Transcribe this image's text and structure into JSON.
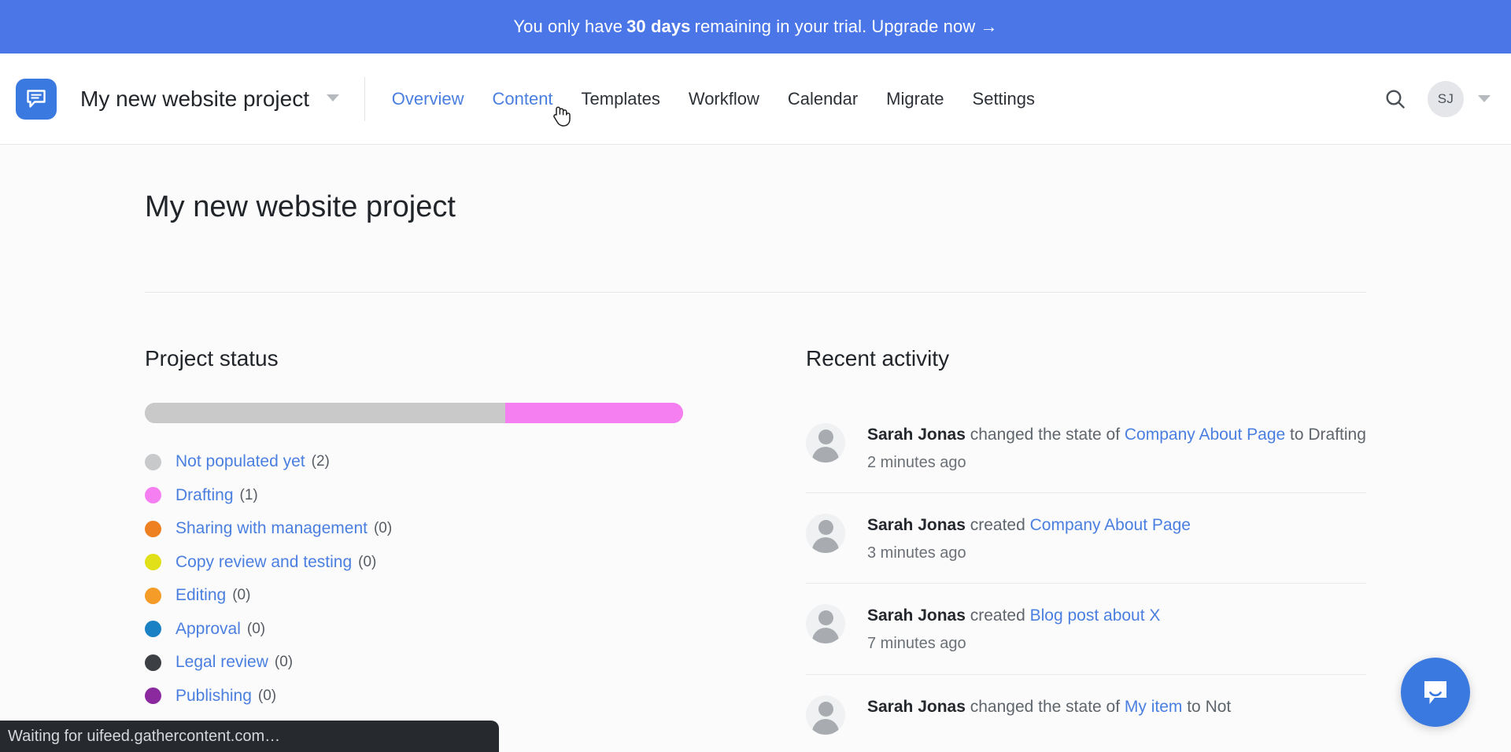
{
  "banner": {
    "pre_text": "You only have",
    "bold_text": "30 days",
    "post_text": "remaining in your trial.",
    "cta": "Upgrade now →",
    "bg_color": "#4a76e8"
  },
  "topnav": {
    "logo_name": "gathercontent-logo-icon",
    "project_name": "My new website project",
    "project_caret": "chevron-down-icon",
    "links": [
      {
        "label": "Overview",
        "state": "active"
      },
      {
        "label": "Content",
        "state": "hovered"
      },
      {
        "label": "Templates",
        "state": "default"
      },
      {
        "label": "Workflow",
        "state": "default"
      },
      {
        "label": "Calendar",
        "state": "default"
      },
      {
        "label": "Migrate",
        "state": "default"
      },
      {
        "label": "Settings",
        "state": "default"
      }
    ],
    "search_icon": "search-icon",
    "avatar_initials": "SJ",
    "avatar_caret": "chevron-down-icon",
    "accent_color": "#4a7fe0"
  },
  "page": {
    "title": "My new website project"
  },
  "project_status": {
    "heading": "Project status",
    "progress": [
      {
        "color": "#c9c9c9",
        "percent": 67
      },
      {
        "color": "#f57ff0",
        "percent": 33
      }
    ],
    "statuses": [
      {
        "label": "Not populated yet",
        "count": "(2)",
        "color": "#c8c9cb"
      },
      {
        "label": "Drafting",
        "count": "(1)",
        "color": "#f57ff0"
      },
      {
        "label": "Sharing with management",
        "count": "(0)",
        "color": "#ef8021"
      },
      {
        "label": "Copy review and testing",
        "count": "(0)",
        "color": "#e2e019"
      },
      {
        "label": "Editing",
        "count": "(0)",
        "color": "#f49b28"
      },
      {
        "label": "Approval",
        "count": "(0)",
        "color": "#1a82c4"
      },
      {
        "label": "Legal review",
        "count": "(0)",
        "color": "#3c3f43"
      },
      {
        "label": "Publishing",
        "count": "(0)",
        "color": "#8a2a9e"
      }
    ]
  },
  "recent_activity": {
    "heading": "Recent activity",
    "items": [
      {
        "user": "Sarah Jonas",
        "action": " changed the state of ",
        "link": "Company About Page",
        "suffix": " to Drafting",
        "time": "2 minutes ago"
      },
      {
        "user": "Sarah Jonas",
        "action": " created ",
        "link": "Company About Page",
        "suffix": "",
        "time": "3 minutes ago"
      },
      {
        "user": "Sarah Jonas",
        "action": " created ",
        "link": "Blog post about X",
        "suffix": "",
        "time": "7 minutes ago"
      },
      {
        "user": "Sarah Jonas",
        "action": " changed the state of ",
        "link": "My item",
        "suffix": " to Not",
        "time": ""
      }
    ]
  },
  "intercom": {
    "icon": "chat-bubble-smile-icon",
    "color": "#3a7ae0"
  },
  "status_bar": {
    "text": "Waiting for uifeed.gathercontent.com…"
  }
}
